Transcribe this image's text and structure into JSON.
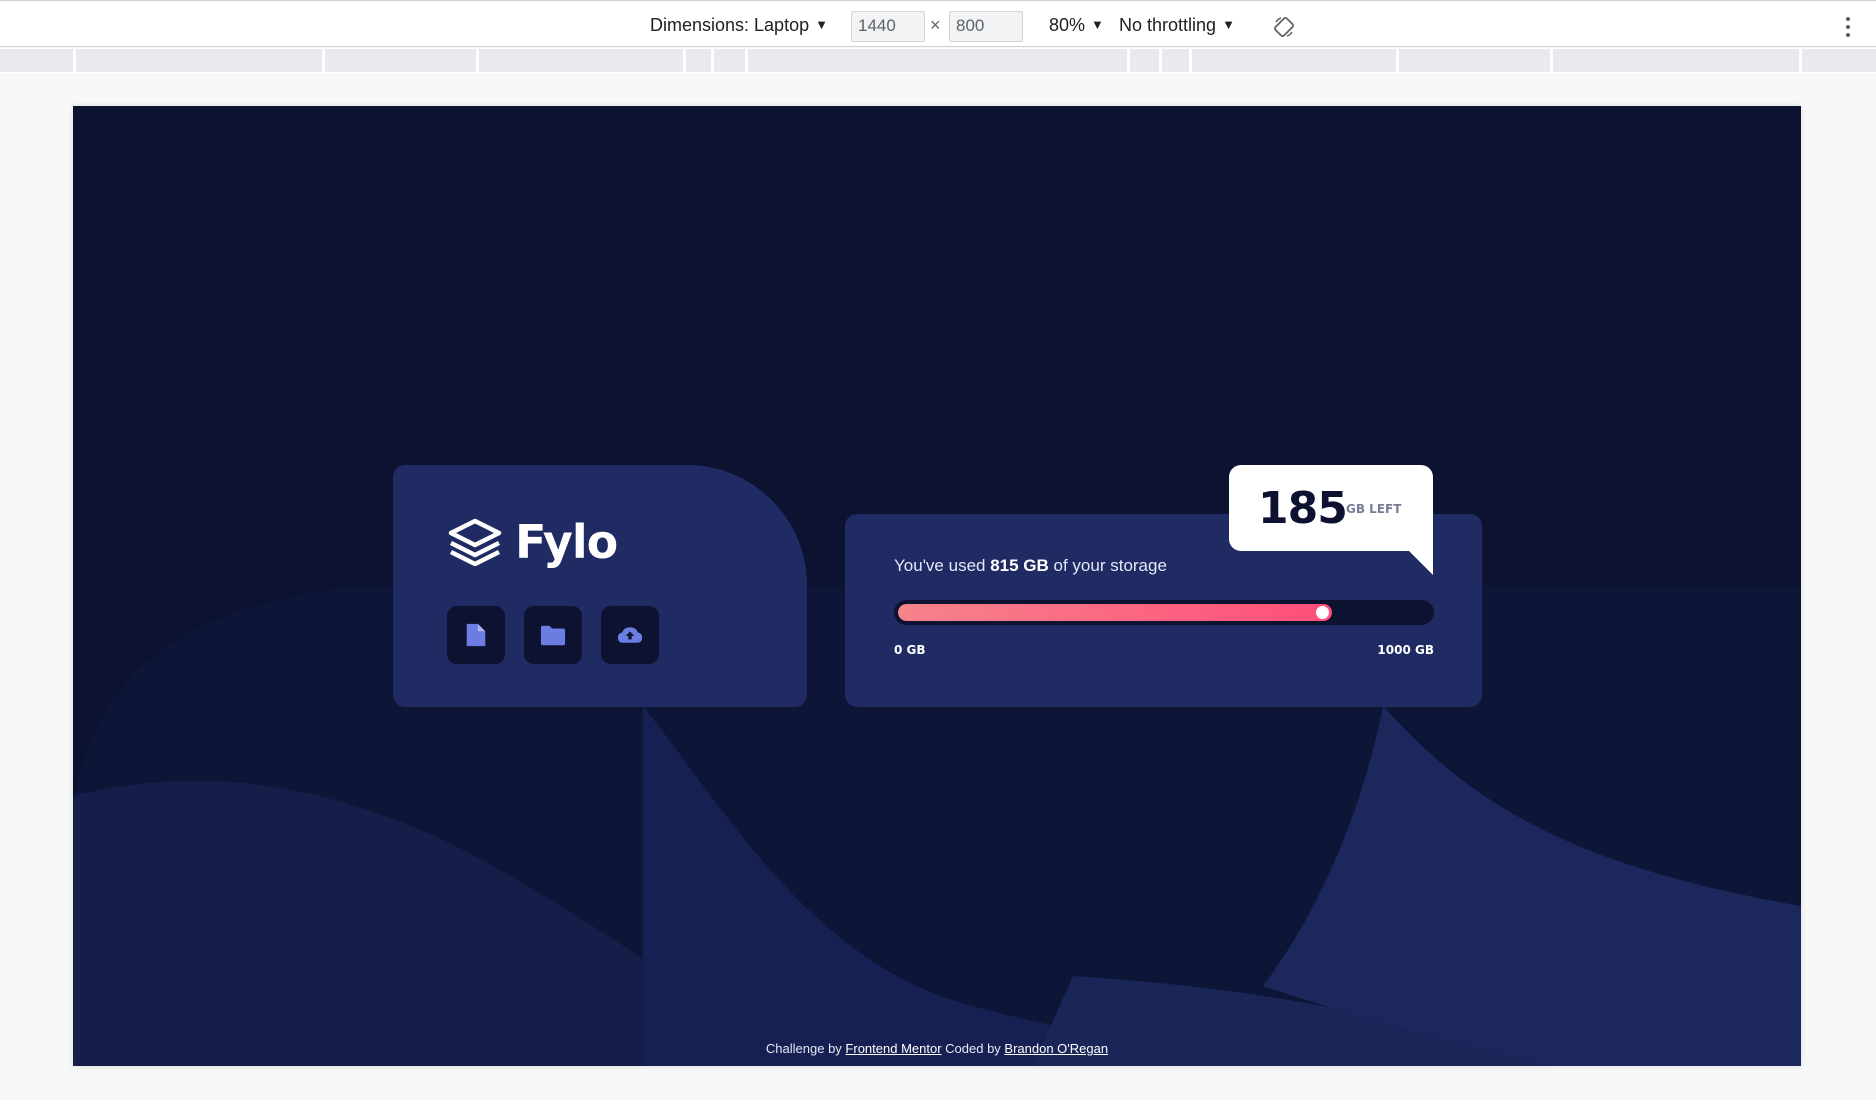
{
  "devtools": {
    "dimensions_label": "Dimensions: Laptop",
    "width_value": "1440",
    "height_value": "800",
    "times": "×",
    "zoom": "80%",
    "throttling": "No throttling",
    "caret": "▼"
  },
  "brand": {
    "name": "Fylo"
  },
  "actions": {
    "document_icon": "document-icon",
    "folder_icon": "folder-icon",
    "upload_icon": "cloud-upload-icon"
  },
  "storage": {
    "usage_prefix": "You've used ",
    "usage_amount": "815 GB",
    "usage_suffix": " of your storage",
    "used_fraction": 0.815,
    "scale_min": "0 GB",
    "scale_max": "1000 GB",
    "remaining_number": "185",
    "remaining_unit": "GB LEFT"
  },
  "attribution": {
    "challenge_prefix": "Challenge by ",
    "challenge_link": "Frontend Mentor",
    "coded_prefix": " Coded by ",
    "coded_link": "Brandon O'Regan"
  },
  "colors": {
    "page_bg": "#0c1230",
    "card_bg": "#1f2b62",
    "accent_start": "#f6838b",
    "accent_end": "#ff4e7a",
    "icon_color": "#6d7ce0"
  }
}
